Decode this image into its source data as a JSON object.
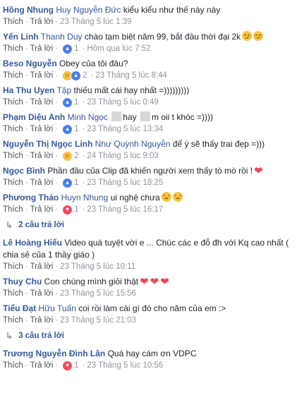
{
  "actions": {
    "like": "Thích",
    "reply": "Trả lời"
  },
  "comments": [
    {
      "author": "Hồng Nhung",
      "mention": "Huy Nguyễn Đức",
      "text": "kiểu kiểu như thế này này",
      "time": "23 Tháng 5 lúc 1:39",
      "reactions": [],
      "count": ""
    },
    {
      "author": "Yến Linh",
      "mention": "Thanh Duy",
      "text": "chào tạm biệt năm 99, bắt đầu thời đại 2k",
      "time": "Hôm qua lúc 7:52",
      "reactions": [
        "like"
      ],
      "count": "1",
      "emojis": [
        "smirk",
        "smirk"
      ]
    },
    {
      "author": "Beso Nguyễn",
      "mention": "",
      "text": "Obey của tôi đâu?",
      "time": "23 Tháng 5 lúc 8:44",
      "reactions": [
        "haha",
        "like"
      ],
      "count": "2"
    },
    {
      "author": "Ha Thu Uyen",
      "mention": "Tập",
      "text": "thiếu mất cái hay nhất =)))))))))",
      "time": "23 Tháng 5 lúc 0:49",
      "reactions": [
        "like"
      ],
      "count": "1"
    },
    {
      "author": "Phạm Diệu Anh",
      "mention": "Minh Ngọc",
      "text": "hay",
      "text2": "m oii t khóc =))))",
      "time": "23 Tháng 5 lúc 13:34",
      "reactions": [
        "like"
      ],
      "count": "1"
    },
    {
      "author": "Nguyễn Thị Ngọc Linh",
      "mention": "Như Quỳnh Nguyễn",
      "text": "để ý sẽ thấy trai đẹp =)))",
      "time": "24 Tháng 5 lúc 9:03",
      "reactions": [
        "haha"
      ],
      "count": "2"
    },
    {
      "author": "Ngọc Bình",
      "mention": "",
      "text": "Phần đầu của Clip đã khiến người xem thấy tò mò rồi !",
      "time": "23 Tháng 5 lúc 18:25",
      "reactions": [
        "like"
      ],
      "count": "1",
      "emojis": [
        "heart"
      ]
    },
    {
      "author": "Phương Thảo",
      "mention": "Huyn Nhung",
      "text": "ui nghệ chưa",
      "time": "23 Tháng 5 lúc 16:17",
      "reactions": [
        "love"
      ],
      "count": "1",
      "emojis": [
        "hearteyes",
        "hearteyes"
      ]
    }
  ],
  "replies1": "2 câu trả lời",
  "comments2": [
    {
      "author": "Lê Hoàng Hiếu",
      "mention": "",
      "text": "Video quá tuyệt vời e ... Chúc các e đỗ đh với Kq cao nhất ( chia sẻ của 1 thầy giáo )",
      "time": "23 Tháng 5 lúc 10:11",
      "reactions": [],
      "count": ""
    },
    {
      "author": "Thuy Chu",
      "mention": "",
      "text": "Con chúng mình giỏi thật",
      "time": "23 Tháng 5 lúc 15:56",
      "reactions": [],
      "count": "",
      "emojis": [
        "heart",
        "heart",
        "heart"
      ]
    },
    {
      "author": "Tiểu Đạt",
      "mention": "Hữu Tuấn",
      "text": "coi rồi làm cái gì đó cho năm của em :>",
      "time": "23 Tháng 5 lúc 21:03",
      "reactions": [],
      "count": ""
    }
  ],
  "replies2": "3 câu trả lời",
  "comments3": [
    {
      "author": "Trương Nguyễn Đình Lân",
      "mention": "",
      "text": "Quá hay cám ơn VDPC",
      "time": "23 Tháng 5 lúc 10:56",
      "reactions": [
        "love"
      ],
      "count": "1"
    }
  ]
}
